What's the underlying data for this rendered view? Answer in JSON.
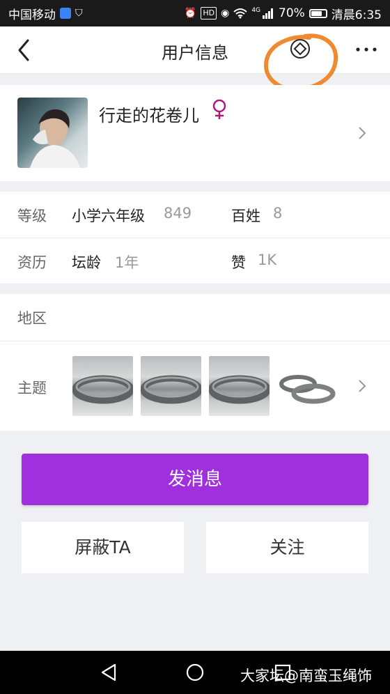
{
  "status_bar": {
    "carrier": "中国移动",
    "network": "4G",
    "battery": "70%",
    "time": "清晨6:35",
    "icons": [
      "shield-icon",
      "notification-icon",
      "alarm-icon",
      "hd-icon",
      "eye-icon",
      "wifi-icon",
      "signal-icon",
      "battery-icon"
    ]
  },
  "nav": {
    "title": "用户信息",
    "back_icon": "chevron-left-icon",
    "action_icon": "diamond-icon",
    "more_icon": "more-icon"
  },
  "profile": {
    "username": "行走的花卷儿",
    "gender_symbol": "♀",
    "gender_color": "#b0167e"
  },
  "stats": {
    "level_label": "等级",
    "level_value": "小学六年级",
    "level_points": "849",
    "rank_label": "百姓",
    "rank_value": "8",
    "seniority_label": "资历",
    "forum_age_label": "坛龄",
    "forum_age_value": "1年",
    "likes_label": "赞",
    "likes_value": "1K"
  },
  "region": {
    "label": "地区",
    "value": ""
  },
  "topics": {
    "label": "主题",
    "thumbnails": [
      "ring-photo-1",
      "ring-photo-2",
      "ring-photo-3",
      "ring-photo-4"
    ]
  },
  "actions": {
    "send_message": "发消息",
    "block": "屏蔽TA",
    "follow": "关注",
    "primary_color": "#a02fde"
  },
  "watermark": "大家坛@南蛮玉绳饰",
  "annotation": {
    "color": "#f08a30"
  }
}
